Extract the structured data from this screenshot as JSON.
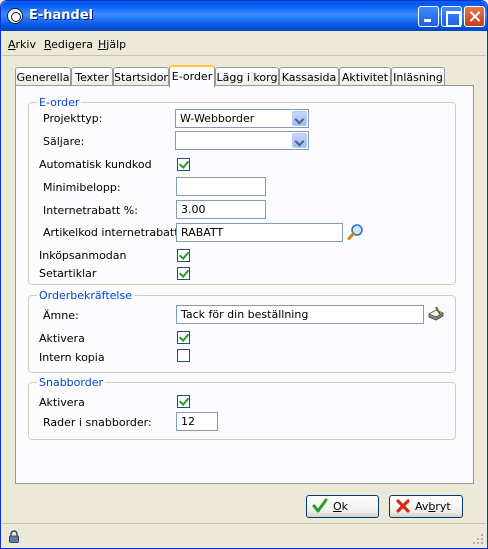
{
  "window": {
    "title": "E-handel"
  },
  "menu": {
    "arkiv_u": "A",
    "arkiv_rest": "rkiv",
    "redigera_u": "R",
    "redigera_rest": "edigera",
    "hjalp_u": "H",
    "hjalp_rest": "jälp"
  },
  "tabs": [
    {
      "label": "Generella"
    },
    {
      "label": "Texter"
    },
    {
      "label": "Startsidor"
    },
    {
      "label": "E-order",
      "active": true
    },
    {
      "label": "Lägg i korg"
    },
    {
      "label": "Kassasida"
    },
    {
      "label": "Aktivitet"
    },
    {
      "label": "Inläsning"
    }
  ],
  "eorder": {
    "group_title": "E-order",
    "projekttyp_label": "Projekttyp:",
    "projekttyp_value": "W-Webborder",
    "saljare_label": "Säljare:",
    "saljare_value": "",
    "auto_kundkod_label": "Automatisk kundkod",
    "auto_kundkod_checked": true,
    "minimibelopp_label": "Minimibelopp:",
    "minimibelopp_value": "",
    "internetrabatt_label": "Internetrabatt %:",
    "internetrabatt_value": "3.00",
    "artikelkod_label": "Artikelkod internetrabatt:",
    "artikelkod_value": "RABATT",
    "inkopsanmodan_label": "Inköpsanmodan",
    "inkopsanmodan_checked": true,
    "setartiklar_label": "Setartiklar",
    "setartiklar_checked": true
  },
  "orderbekraftelse": {
    "group_title": "Orderbekräftelse",
    "amne_label": "Ämne:",
    "amne_value": "Tack för din beställning",
    "aktivera_label": "Aktivera",
    "aktivera_checked": true,
    "intern_kopia_label": "Intern kopia",
    "intern_kopia_checked": false
  },
  "snabborder": {
    "group_title": "Snabborder",
    "aktivera_label": "Aktivera",
    "aktivera_checked": true,
    "rader_label": "Rader i snabborder:",
    "rader_value": "12"
  },
  "buttons": {
    "ok_u": "O",
    "ok_rest": "k",
    "avbryt_pre": "Av",
    "avbryt_u": "b",
    "avbryt_rest": "ryt"
  },
  "colors": {
    "group_title": "#0046d5",
    "title_bar": "#0058ee",
    "active_tab_highlight": "#ffc83c"
  }
}
